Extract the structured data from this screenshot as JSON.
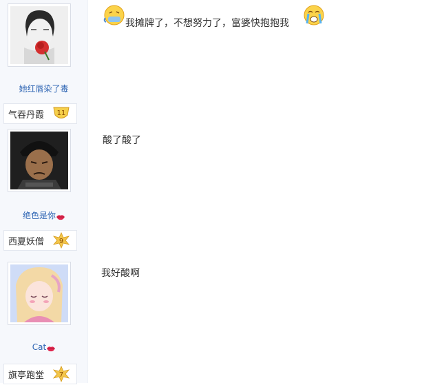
{
  "posts": [
    {
      "author": "她红唇染了毒",
      "badge": {
        "name": "气吞丹霞",
        "level": "11"
      },
      "text": "我摊牌了，不想努力了，富婆快抱抱我",
      "emojis": [
        "sick-face-emoji",
        "crying-face-emoji"
      ]
    },
    {
      "author": "绝色是你",
      "badge": {
        "name": "西夏妖僧",
        "level": "9"
      },
      "text": "酸了酸了"
    },
    {
      "author": "Cat",
      "badge": {
        "name": "旗亭跑堂",
        "level": "7"
      },
      "text": "我好酸啊"
    }
  ],
  "colors": {
    "username": "#2d64b3",
    "badge_gold": "#f0c040",
    "lips": "#e0284f"
  }
}
